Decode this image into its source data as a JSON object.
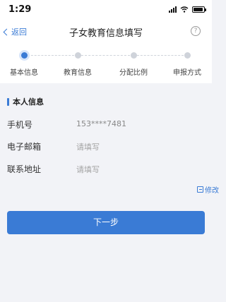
{
  "status_bar": {
    "time": "1:29"
  },
  "nav": {
    "back_label": "返回",
    "title": "子女教育信息填写",
    "help_symbol": "?"
  },
  "steps": [
    {
      "label": "基本信息",
      "active": true
    },
    {
      "label": "教育信息",
      "active": false
    },
    {
      "label": "分配比例",
      "active": false
    },
    {
      "label": "申报方式",
      "active": false
    }
  ],
  "section": {
    "title": "本人信息"
  },
  "form": {
    "phone": {
      "label": "手机号",
      "value": "153****7481"
    },
    "email": {
      "label": "电子邮箱",
      "placeholder": "请填写"
    },
    "address": {
      "label": "联系地址",
      "placeholder": "请填写"
    }
  },
  "edit_label": "修改",
  "next_button_label": "下一步",
  "colors": {
    "accent": "#3a7bd5",
    "background": "#f2f3f7"
  }
}
